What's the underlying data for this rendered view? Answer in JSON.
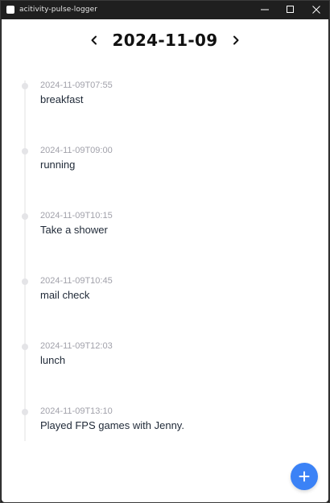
{
  "window": {
    "title": "acitivity-pulse-logger"
  },
  "header": {
    "date": "2024-11-09"
  },
  "entries": [
    {
      "time": "2024-11-09T07:55",
      "text": "breakfast"
    },
    {
      "time": "2024-11-09T09:00",
      "text": "running"
    },
    {
      "time": "2024-11-09T10:15",
      "text": "Take a shower"
    },
    {
      "time": "2024-11-09T10:45",
      "text": "mail check"
    },
    {
      "time": "2024-11-09T12:03",
      "text": "lunch"
    },
    {
      "time": "2024-11-09T13:10",
      "text": "Played FPS games with Jenny."
    }
  ],
  "icons": {
    "prev": "chevron-left-icon",
    "next": "chevron-right-icon",
    "add": "plus-icon",
    "minimize": "minimize-icon",
    "maximize": "maximize-icon",
    "close": "close-icon"
  },
  "colors": {
    "fab": "#3b82f6",
    "timeline_dot": "#e4e4e7",
    "time_text": "#a1a1aa",
    "entry_text": "#1f2937"
  }
}
